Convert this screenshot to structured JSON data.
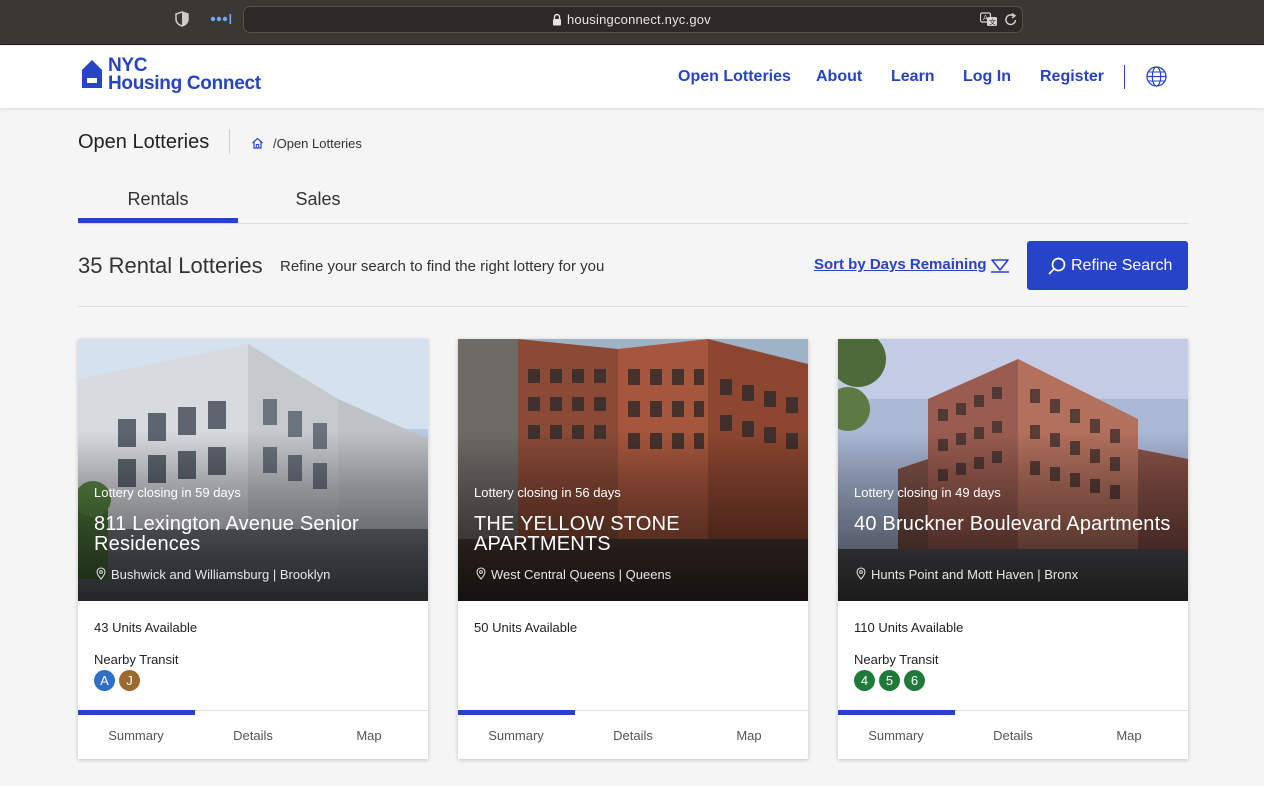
{
  "browser": {
    "url": "housingconnect.nyc.gov",
    "icons": [
      "shield-icon",
      "tab-dots-icon",
      "lock-icon",
      "translate-icon",
      "reload-icon"
    ]
  },
  "header": {
    "logo_line1": "NYC",
    "logo_line2": "Housing Connect",
    "nav": [
      "Open Lotteries",
      "About",
      "Learn",
      "Log In",
      "Register"
    ],
    "accent_color": "#2743c8"
  },
  "page": {
    "title": "Open Lotteries",
    "breadcrumb": "/Open Lotteries",
    "tabs": [
      "Rentals",
      "Sales"
    ],
    "active_tab": "Rentals"
  },
  "results": {
    "count_label": "35 Rental Lotteries",
    "hint": "Refine your search to find the right lottery for you",
    "sort_label": "Sort by Days Remaining",
    "refine_label": "Refine Search"
  },
  "cards": [
    {
      "closing": "Lottery closing in 59 days",
      "name": "811 Lexington Avenue Senior Residences",
      "location": "Bushwick and Williamsburg | Brooklyn",
      "units": "43 Units Available",
      "transit_label": "Nearby Transit",
      "transit": [
        {
          "label": "A",
          "color": "#2f6fc4"
        },
        {
          "label": "J",
          "color": "#9b6a2f"
        }
      ],
      "tabs": [
        "Summary",
        "Details",
        "Map"
      ]
    },
    {
      "closing": "Lottery closing in 56 days",
      "name": "THE YELLOW STONE APARTMENTS",
      "location": "West Central Queens | Queens",
      "units": "50 Units Available",
      "tabs": [
        "Summary",
        "Details",
        "Map"
      ]
    },
    {
      "closing": "Lottery closing in 49 days",
      "name": "40 Bruckner Boulevard Apartments",
      "location": "Hunts Point and Mott Haven | Bronx",
      "units": "110 Units Available",
      "transit_label": "Nearby Transit",
      "transit": [
        {
          "label": "4",
          "color": "#1f7a3a"
        },
        {
          "label": "5",
          "color": "#1f7a3a"
        },
        {
          "label": "6",
          "color": "#1f7a3a"
        }
      ],
      "tabs": [
        "Summary",
        "Details",
        "Map"
      ]
    }
  ]
}
